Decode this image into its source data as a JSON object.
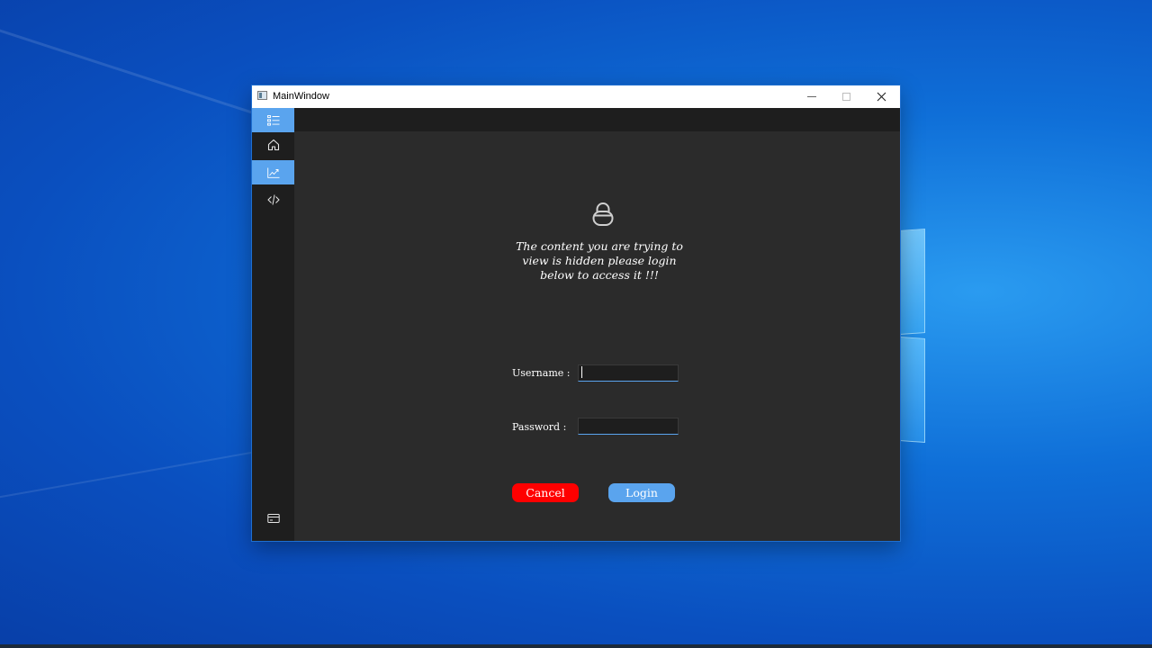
{
  "window": {
    "title": "MainWindow",
    "controls": {
      "minimize": "minimize-icon",
      "maximize": "maximize-icon",
      "close": "close-icon"
    }
  },
  "sidebar": {
    "items": [
      {
        "icon": "list-icon",
        "active": true
      },
      {
        "icon": "home-icon",
        "active": false
      },
      {
        "icon": "chart-icon",
        "active": true
      },
      {
        "icon": "code-icon",
        "active": false
      }
    ],
    "footer_icon": "card-icon"
  },
  "content": {
    "lock_icon": "lock-icon",
    "message": "The content you are trying to view is hidden please login below to access it !!!",
    "username_label": "Username :",
    "username_value": "",
    "password_label": "Password :",
    "password_value": "",
    "cancel_label": "Cancel",
    "login_label": "Login"
  },
  "colors": {
    "accent": "#5aa4ee",
    "cancel": "#ff0000",
    "sidebar_bg": "#1e1e1e",
    "content_bg": "#2b2b2b"
  }
}
